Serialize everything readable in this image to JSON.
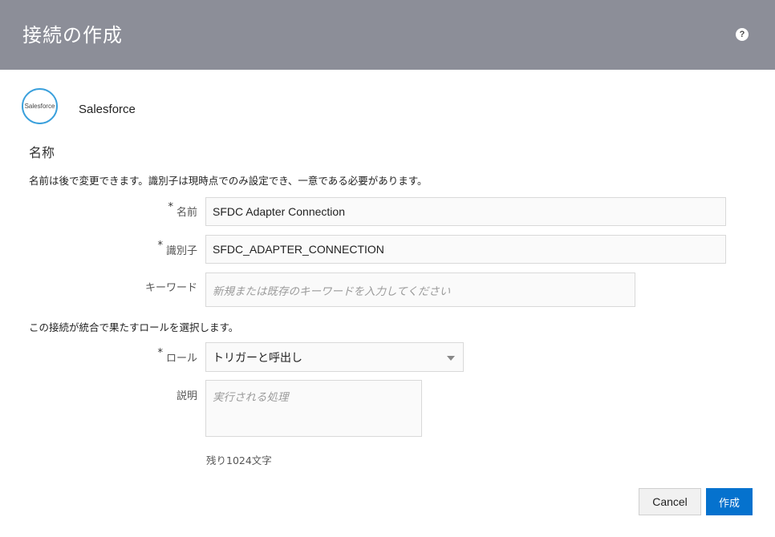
{
  "header": {
    "title": "接続の作成",
    "help_label": "?"
  },
  "adapter": {
    "logo_text": "Salesforce",
    "name": "Salesforce"
  },
  "section": {
    "title": "名称",
    "description": "名前は後で変更できます。識別子は現時点でのみ設定でき、一意である必要があります。"
  },
  "fields": {
    "required_mark": "*",
    "name": {
      "label": "名前",
      "value": "SFDC Adapter Connection"
    },
    "identifier": {
      "label": "識別子",
      "value": "SFDC_ADAPTER_CONNECTION"
    },
    "keywords": {
      "label": "キーワード",
      "placeholder": "新規または既存のキーワードを入力してください"
    }
  },
  "role_section": {
    "description": "この接続が統合で果たすロールを選択します。",
    "role_label": "ロール",
    "role_value": "トリガーと呼出し",
    "desc_label": "説明",
    "desc_placeholder": "実行される処理",
    "remaining": "残り1024文字"
  },
  "buttons": {
    "cancel": "Cancel",
    "create": "作成"
  }
}
